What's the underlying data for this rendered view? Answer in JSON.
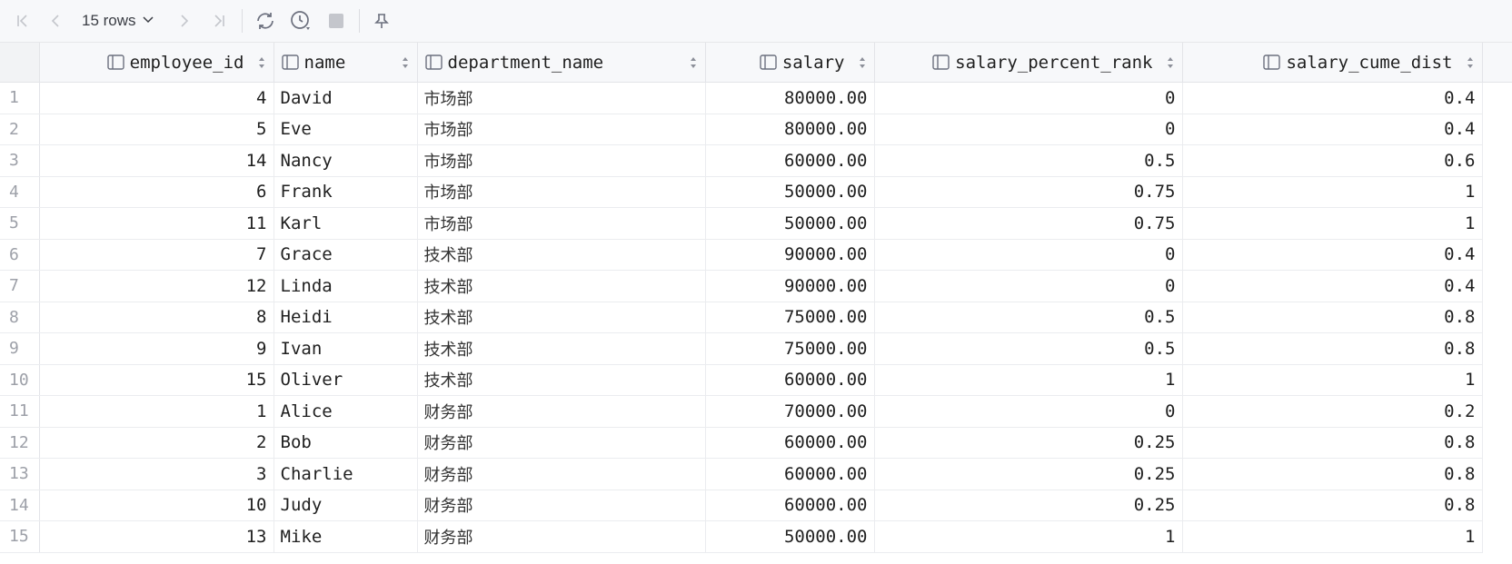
{
  "toolbar": {
    "rows_label": "15 rows",
    "buttons": [
      "first-page-icon",
      "prev-page-icon",
      "next-page-icon",
      "last-page-icon",
      "refresh-icon",
      "history-icon",
      "stop-icon",
      "pin-icon"
    ]
  },
  "table": {
    "columns": [
      {
        "key": "employee_id",
        "label": "employee_id"
      },
      {
        "key": "name",
        "label": "name"
      },
      {
        "key": "department_name",
        "label": "department_name"
      },
      {
        "key": "salary",
        "label": "salary"
      },
      {
        "key": "salary_percent_rank",
        "label": "salary_percent_rank"
      },
      {
        "key": "salary_cume_dist",
        "label": "salary_cume_dist"
      }
    ],
    "rows": [
      {
        "n": "1",
        "employee_id": "4",
        "name": "David",
        "department_name": "市场部",
        "salary": "80000.00",
        "salary_percent_rank": "0",
        "salary_cume_dist": "0.4"
      },
      {
        "n": "2",
        "employee_id": "5",
        "name": "Eve",
        "department_name": "市场部",
        "salary": "80000.00",
        "salary_percent_rank": "0",
        "salary_cume_dist": "0.4"
      },
      {
        "n": "3",
        "employee_id": "14",
        "name": "Nancy",
        "department_name": "市场部",
        "salary": "60000.00",
        "salary_percent_rank": "0.5",
        "salary_cume_dist": "0.6"
      },
      {
        "n": "4",
        "employee_id": "6",
        "name": "Frank",
        "department_name": "市场部",
        "salary": "50000.00",
        "salary_percent_rank": "0.75",
        "salary_cume_dist": "1"
      },
      {
        "n": "5",
        "employee_id": "11",
        "name": "Karl",
        "department_name": "市场部",
        "salary": "50000.00",
        "salary_percent_rank": "0.75",
        "salary_cume_dist": "1"
      },
      {
        "n": "6",
        "employee_id": "7",
        "name": "Grace",
        "department_name": "技术部",
        "salary": "90000.00",
        "salary_percent_rank": "0",
        "salary_cume_dist": "0.4"
      },
      {
        "n": "7",
        "employee_id": "12",
        "name": "Linda",
        "department_name": "技术部",
        "salary": "90000.00",
        "salary_percent_rank": "0",
        "salary_cume_dist": "0.4"
      },
      {
        "n": "8",
        "employee_id": "8",
        "name": "Heidi",
        "department_name": "技术部",
        "salary": "75000.00",
        "salary_percent_rank": "0.5",
        "salary_cume_dist": "0.8"
      },
      {
        "n": "9",
        "employee_id": "9",
        "name": "Ivan",
        "department_name": "技术部",
        "salary": "75000.00",
        "salary_percent_rank": "0.5",
        "salary_cume_dist": "0.8"
      },
      {
        "n": "10",
        "employee_id": "15",
        "name": "Oliver",
        "department_name": "技术部",
        "salary": "60000.00",
        "salary_percent_rank": "1",
        "salary_cume_dist": "1"
      },
      {
        "n": "11",
        "employee_id": "1",
        "name": "Alice",
        "department_name": "财务部",
        "salary": "70000.00",
        "salary_percent_rank": "0",
        "salary_cume_dist": "0.2"
      },
      {
        "n": "12",
        "employee_id": "2",
        "name": "Bob",
        "department_name": "财务部",
        "salary": "60000.00",
        "salary_percent_rank": "0.25",
        "salary_cume_dist": "0.8"
      },
      {
        "n": "13",
        "employee_id": "3",
        "name": "Charlie",
        "department_name": "财务部",
        "salary": "60000.00",
        "salary_percent_rank": "0.25",
        "salary_cume_dist": "0.8"
      },
      {
        "n": "14",
        "employee_id": "10",
        "name": "Judy",
        "department_name": "财务部",
        "salary": "60000.00",
        "salary_percent_rank": "0.25",
        "salary_cume_dist": "0.8"
      },
      {
        "n": "15",
        "employee_id": "13",
        "name": "Mike",
        "department_name": "财务部",
        "salary": "50000.00",
        "salary_percent_rank": "1",
        "salary_cume_dist": "1"
      }
    ]
  }
}
